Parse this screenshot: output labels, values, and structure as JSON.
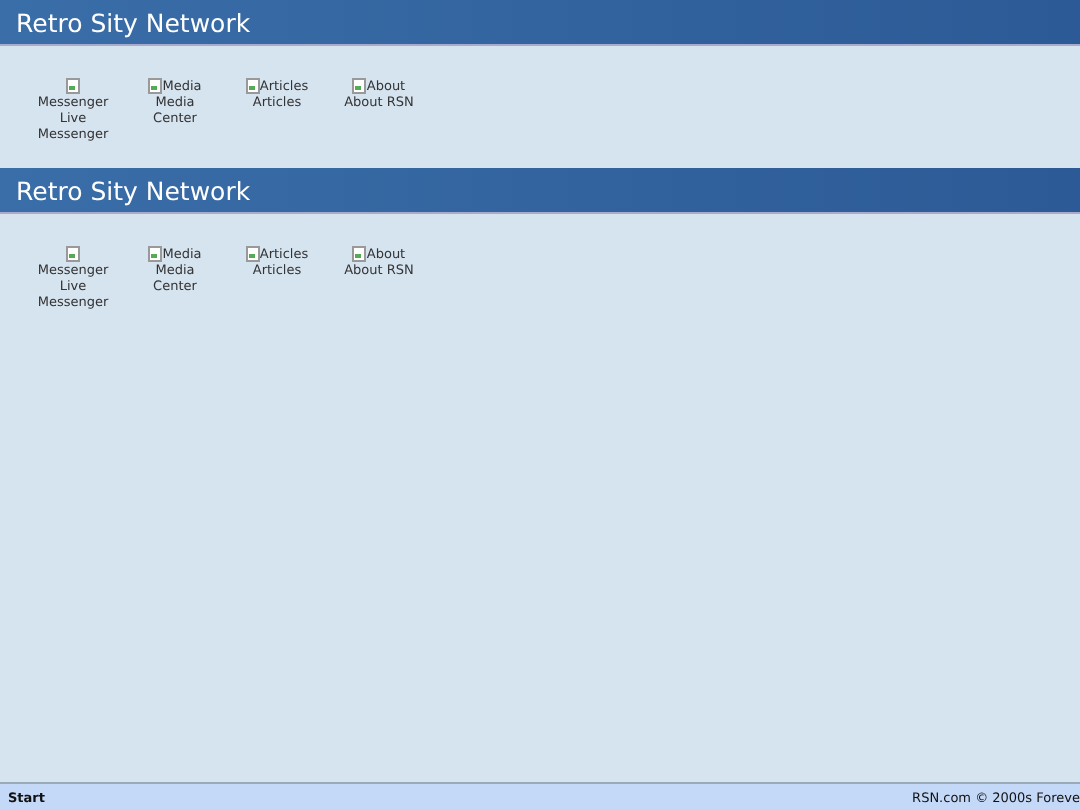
{
  "sections": [
    {
      "title": "Retro Sity Network",
      "items": [
        {
          "alt": "Messenger",
          "label": "Live Messenger"
        },
        {
          "alt": "Media",
          "label": "Media Center"
        },
        {
          "alt": "Articles",
          "label": "Articles"
        },
        {
          "alt": "About",
          "label": "About RSN"
        }
      ]
    },
    {
      "title": "Retro Sity Network",
      "items": [
        {
          "alt": "Messenger",
          "label": "Live Messenger"
        },
        {
          "alt": "Media",
          "label": "Media Center"
        },
        {
          "alt": "Articles",
          "label": "Articles"
        },
        {
          "alt": "About",
          "label": "About RSN"
        }
      ]
    }
  ],
  "taskbar": {
    "start": "Start",
    "copyright": "RSN.com © 2000s Foreve"
  }
}
